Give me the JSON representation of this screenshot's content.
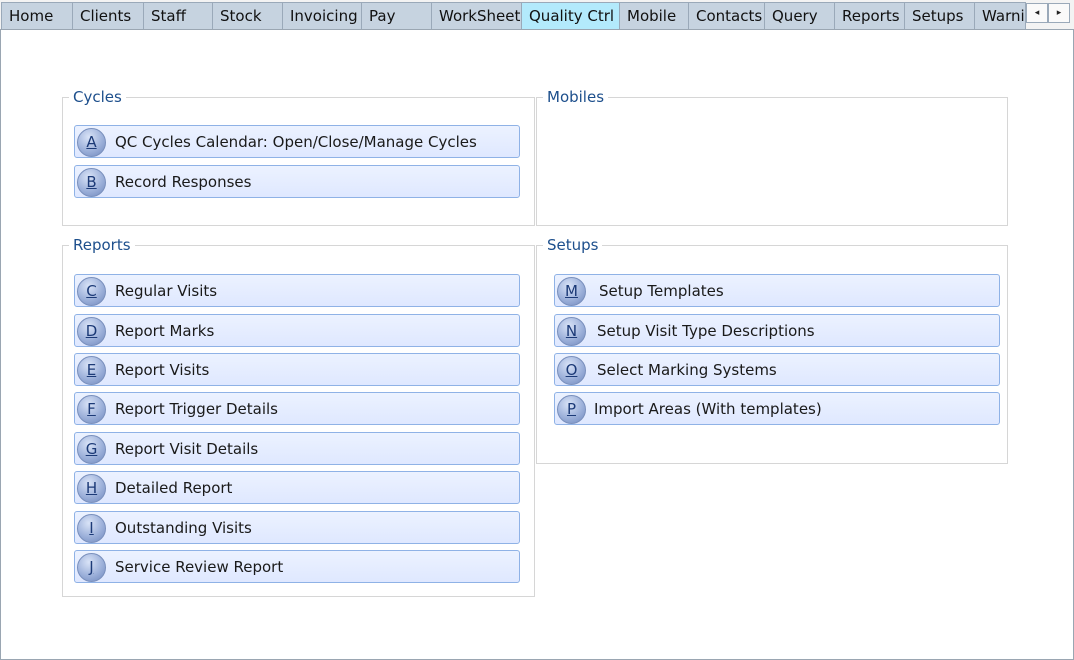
{
  "tabs": [
    {
      "label": "Home"
    },
    {
      "label": "Clients"
    },
    {
      "label": "Staff"
    },
    {
      "label": "Stock"
    },
    {
      "label": "Invoicing"
    },
    {
      "label": "Pay"
    },
    {
      "label": "WorkSheet"
    },
    {
      "label": "Quality Ctrl"
    },
    {
      "label": "Mobile"
    },
    {
      "label": "Contacts"
    },
    {
      "label": "Query"
    },
    {
      "label": "Reports"
    },
    {
      "label": "Setups"
    },
    {
      "label": "Warni"
    }
  ],
  "scroll": {
    "left": "◂",
    "right": "▸"
  },
  "groups": {
    "cycles": {
      "title": "Cycles",
      "items": [
        {
          "key": "A",
          "label": "QC Cycles Calendar: Open/Close/Manage Cycles"
        },
        {
          "key": "B",
          "label": "Record Responses"
        }
      ]
    },
    "mobiles": {
      "title": "Mobiles"
    },
    "reports": {
      "title": "Reports",
      "items": [
        {
          "key": "C",
          "label": "Regular Visits"
        },
        {
          "key": "D",
          "label": "Report Marks"
        },
        {
          "key": "E",
          "label": "Report Visits"
        },
        {
          "key": "F",
          "label": "Report Trigger Details"
        },
        {
          "key": "G",
          "label": "Report Visit Details"
        },
        {
          "key": "H",
          "label": "Detailed Report"
        },
        {
          "key": "I",
          "label": "Outstanding Visits"
        },
        {
          "key": "J",
          "label": "Service Review Report"
        }
      ]
    },
    "setups": {
      "title": "Setups",
      "items": [
        {
          "key": "M",
          "label": "Setup Templates"
        },
        {
          "key": "N",
          "label": "Setup Visit Type Descriptions"
        },
        {
          "key": "O",
          "label": "Select Marking Systems"
        },
        {
          "key": "P",
          "label": "Import Areas (With templates)"
        }
      ]
    }
  }
}
